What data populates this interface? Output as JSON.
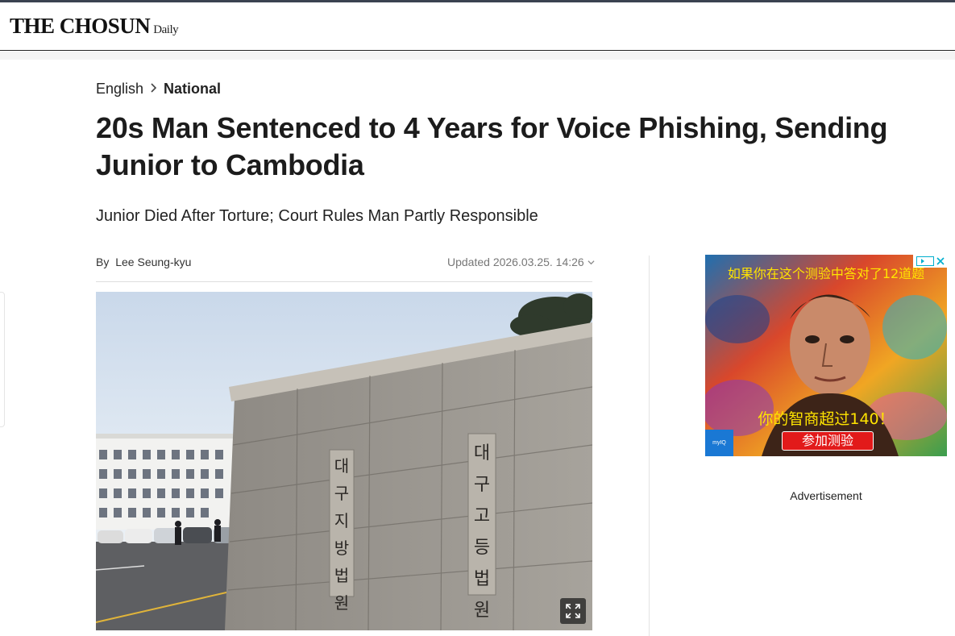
{
  "header": {
    "logo_main": "THE CHOSUN",
    "logo_sub": "Daily"
  },
  "breadcrumb": {
    "section": "English",
    "separator": ">",
    "category": "National"
  },
  "article": {
    "headline": "20s Man Sentenced to 4 Years for Voice Phishing, Sending Junior to Cambodia",
    "subheadline": "Junior Died After Torture; Court Rules Man Partly Responsible",
    "byline_prefix": "By",
    "author": "Lee Seung-kyu",
    "updated": "Updated 2026.03.25. 14:26"
  },
  "photo": {
    "sign_left": [
      "대",
      "구",
      "지",
      "방",
      "법",
      "원"
    ],
    "sign_right": [
      "대",
      "구",
      "고",
      "등",
      "법",
      "원"
    ],
    "expand_icon": "expand-icon"
  },
  "ad": {
    "headline": "如果你在这个测验中答对了12道题",
    "tagline": "你的智商超过140！",
    "cta": "参加测验",
    "brand": "myIQ",
    "label": "Advertisement"
  },
  "colors": {
    "top_line": "#3b4250",
    "ad_text": "#ffe400",
    "ad_button": "#e21a1a"
  }
}
